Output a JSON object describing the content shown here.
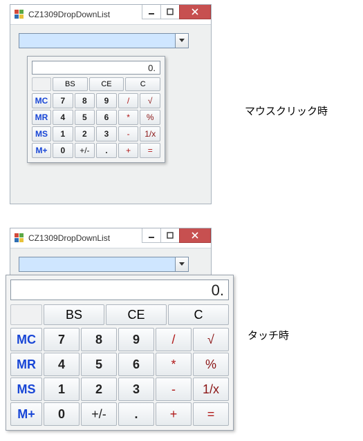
{
  "top": {
    "title": "CZ1309DropDownList",
    "caption": "マウスクリック時",
    "calc_display": "0.",
    "topbar": [
      "",
      "BS",
      "CE",
      "C"
    ],
    "rows": [
      [
        {
          "t": "MC",
          "c": "c-blue"
        },
        {
          "t": "7",
          "c": "c-blk c-bold"
        },
        {
          "t": "8",
          "c": "c-blk c-bold"
        },
        {
          "t": "9",
          "c": "c-blk c-bold"
        },
        {
          "t": "/",
          "c": "c-red"
        },
        {
          "t": "√",
          "c": "c-dred"
        }
      ],
      [
        {
          "t": "MR",
          "c": "c-blue"
        },
        {
          "t": "4",
          "c": "c-blk c-bold"
        },
        {
          "t": "5",
          "c": "c-blk c-bold"
        },
        {
          "t": "6",
          "c": "c-blk c-bold"
        },
        {
          "t": "*",
          "c": "c-red"
        },
        {
          "t": "%",
          "c": "c-dred"
        }
      ],
      [
        {
          "t": "MS",
          "c": "c-blue"
        },
        {
          "t": "1",
          "c": "c-blk c-bold"
        },
        {
          "t": "2",
          "c": "c-blk c-bold"
        },
        {
          "t": "3",
          "c": "c-blk c-bold"
        },
        {
          "t": "-",
          "c": "c-red"
        },
        {
          "t": "1/x",
          "c": "c-dred"
        }
      ],
      [
        {
          "t": "M+",
          "c": "c-blue"
        },
        {
          "t": "0",
          "c": "c-blk c-bold"
        },
        {
          "t": "+/-",
          "c": "c-blk"
        },
        {
          "t": ".",
          "c": "c-blk c-bold"
        },
        {
          "t": "+",
          "c": "c-red"
        },
        {
          "t": "=",
          "c": "c-red"
        }
      ]
    ]
  },
  "bottom": {
    "title": "CZ1309DropDownList",
    "caption": "タッチ時",
    "calc_display": "0.",
    "topbar": [
      "",
      "BS",
      "CE",
      "C"
    ],
    "rows": [
      [
        {
          "t": "MC",
          "c": "c-blue"
        },
        {
          "t": "7",
          "c": "c-blk c-bold"
        },
        {
          "t": "8",
          "c": "c-blk c-bold"
        },
        {
          "t": "9",
          "c": "c-blk c-bold"
        },
        {
          "t": "/",
          "c": "c-red"
        },
        {
          "t": "√",
          "c": "c-dred"
        }
      ],
      [
        {
          "t": "MR",
          "c": "c-blue"
        },
        {
          "t": "4",
          "c": "c-blk c-bold"
        },
        {
          "t": "5",
          "c": "c-blk c-bold"
        },
        {
          "t": "6",
          "c": "c-blk c-bold"
        },
        {
          "t": "*",
          "c": "c-red"
        },
        {
          "t": "%",
          "c": "c-dred"
        }
      ],
      [
        {
          "t": "MS",
          "c": "c-blue"
        },
        {
          "t": "1",
          "c": "c-blk c-bold"
        },
        {
          "t": "2",
          "c": "c-blk c-bold"
        },
        {
          "t": "3",
          "c": "c-blk c-bold"
        },
        {
          "t": "-",
          "c": "c-red"
        },
        {
          "t": "1/x",
          "c": "c-dred"
        }
      ],
      [
        {
          "t": "M+",
          "c": "c-blue"
        },
        {
          "t": "0",
          "c": "c-blk c-bold"
        },
        {
          "t": "+/-",
          "c": "c-blk"
        },
        {
          "t": ".",
          "c": "c-blk c-bold"
        },
        {
          "t": "+",
          "c": "c-red"
        },
        {
          "t": "=",
          "c": "c-red"
        }
      ]
    ]
  }
}
